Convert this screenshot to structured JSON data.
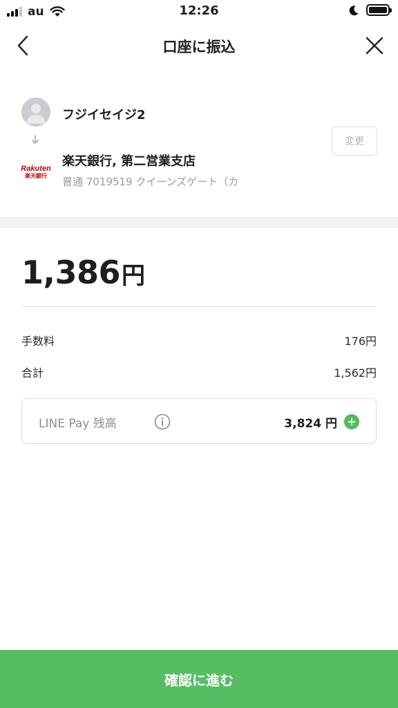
{
  "status_bar": {
    "carrier": "au",
    "time": "12:26"
  },
  "header": {
    "title": "口座に振込"
  },
  "recipient": {
    "name": "フジイセイジ2",
    "bank_name": "楽天銀行, 第二営業支店",
    "account_line": "普通 7019519 クイーンズゲート（カ",
    "change_label": "変更",
    "bank_logo": {
      "line1": "Rakuten",
      "line2": "楽天銀行",
      "color": "#bf0000"
    }
  },
  "amount": {
    "value": "1,386",
    "unit": "円"
  },
  "fee": {
    "label": "手数料",
    "value": "176円"
  },
  "total": {
    "label": "合計",
    "value": "1,562円"
  },
  "balance": {
    "label": "LINE Pay 残高",
    "value": "3,824 円",
    "icons": [
      "info-icon",
      "add-icon"
    ]
  },
  "confirm_button": {
    "label": "確認に進む"
  },
  "colors": {
    "accent_green": "#56bd63",
    "muted_text": "#9b9b9b",
    "band": "#f2f2f4"
  }
}
